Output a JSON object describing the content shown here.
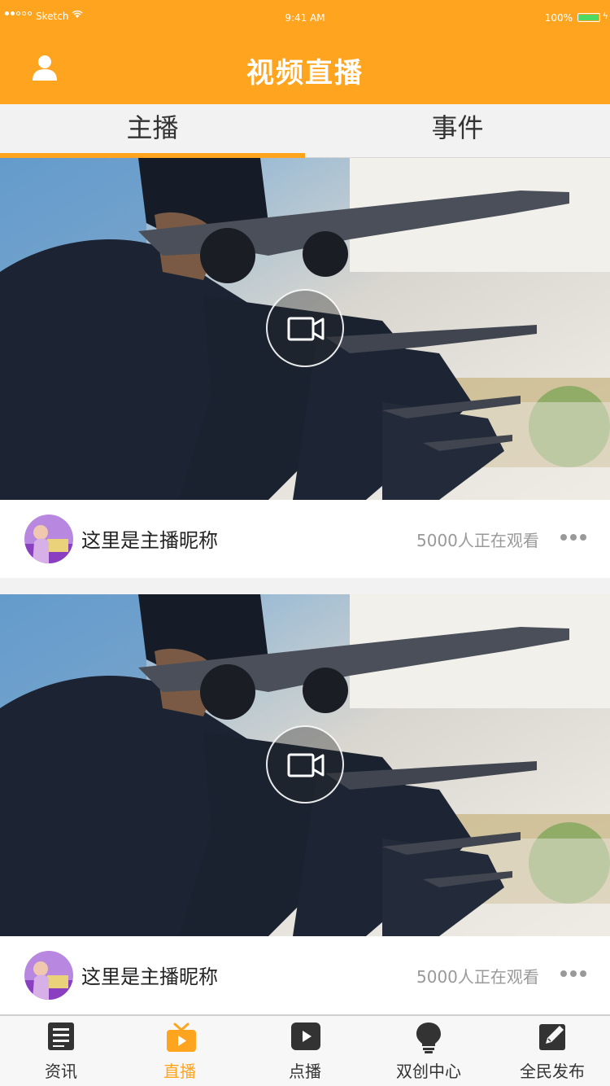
{
  "status_bar": {
    "carrier": "Sketch",
    "time": "9:41 AM",
    "battery": "100%"
  },
  "nav": {
    "title": "视频直播",
    "user_icon": "user-icon"
  },
  "tabs": [
    {
      "label": "主播",
      "active": true
    },
    {
      "label": "事件",
      "active": false
    }
  ],
  "feed": [
    {
      "nickname": "这里是主播昵称",
      "viewers": "5000人正在观看"
    },
    {
      "nickname": "这里是主播昵称",
      "viewers": "5000人正在观看"
    }
  ],
  "tabbar": [
    {
      "label": "资讯",
      "icon": "news-icon",
      "active": false
    },
    {
      "label": "直播",
      "icon": "tv-icon",
      "active": true
    },
    {
      "label": "点播",
      "icon": "play-icon",
      "active": false
    },
    {
      "label": "双创中心",
      "icon": "lightbulb-icon",
      "active": false
    },
    {
      "label": "全民发布",
      "icon": "edit-icon",
      "active": false
    }
  ],
  "colors": {
    "accent": "#ffa41f",
    "background": "#f2f2f2"
  }
}
